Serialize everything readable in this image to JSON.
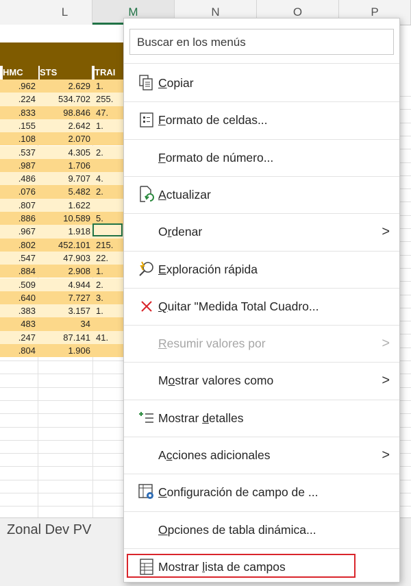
{
  "columns": [
    {
      "letter": "L",
      "selected": false
    },
    {
      "letter": "M",
      "selected": true
    },
    {
      "letter": "N",
      "selected": false
    },
    {
      "letter": "O",
      "selected": false
    },
    {
      "letter": "P",
      "selected": false
    }
  ],
  "table": {
    "headers": [
      "HMC",
      "STS",
      "TRAI"
    ],
    "rows": [
      [
        ".962",
        "2.629",
        "1."
      ],
      [
        ".224",
        "534.702",
        "255."
      ],
      [
        ".833",
        "98.846",
        "47."
      ],
      [
        ".155",
        "2.642",
        "1."
      ],
      [
        ".108",
        "2.070",
        ""
      ],
      [
        ".537",
        "4.305",
        "2."
      ],
      [
        ".987",
        "1.706",
        ""
      ],
      [
        ".486",
        "9.707",
        "4."
      ],
      [
        ".076",
        "5.482",
        "2."
      ],
      [
        ".807",
        "1.622",
        ""
      ],
      [
        ".886",
        "10.589",
        "5."
      ],
      [
        ".967",
        "1.918",
        ""
      ],
      [
        ".802",
        "452.101",
        "215."
      ],
      [
        ".547",
        "47.903",
        "22."
      ],
      [
        ".884",
        "2.908",
        "1."
      ],
      [
        ".509",
        "4.944",
        "2."
      ],
      [
        ".640",
        "7.727",
        "3."
      ],
      [
        ".383",
        "3.157",
        "1."
      ],
      [
        "483",
        "34",
        ""
      ],
      [
        ".247",
        "87.141",
        "41."
      ],
      [
        ".804",
        "1.906",
        ""
      ]
    ]
  },
  "sheet_tab": "Zonal Dev PV",
  "menu": {
    "search_placeholder": "Buscar en los menús",
    "items": [
      {
        "pre": "",
        "ul": "C",
        "post": "opiar",
        "icon": "copy-icon",
        "disabled": false,
        "submenu": false
      },
      {
        "pre": "",
        "ul": "F",
        "post": "ormato de celdas...",
        "icon": "format-cells-icon",
        "disabled": false,
        "submenu": false
      },
      {
        "pre": "",
        "ul": "F",
        "post": "ormato de número...",
        "icon": "",
        "disabled": false,
        "submenu": false
      },
      {
        "pre": "",
        "ul": "A",
        "post": "ctualizar",
        "icon": "refresh-icon",
        "disabled": false,
        "submenu": false
      },
      {
        "pre": "O",
        "ul": "r",
        "post": "denar",
        "icon": "",
        "disabled": false,
        "submenu": true
      },
      {
        "pre": "",
        "ul": "E",
        "post": "xploración rápida",
        "icon": "quick-explore-icon",
        "disabled": false,
        "submenu": false
      },
      {
        "pre": "",
        "ul": "Q",
        "post": "uitar \"Medida Total Cuadro...",
        "icon": "remove-icon",
        "disabled": false,
        "submenu": false
      },
      {
        "pre": "",
        "ul": "R",
        "post": "esumir valores por",
        "icon": "",
        "disabled": true,
        "submenu": true
      },
      {
        "pre": "M",
        "ul": "o",
        "post": "strar valores como",
        "icon": "",
        "disabled": false,
        "submenu": true
      },
      {
        "pre": "Mostrar ",
        "ul": "d",
        "post": "etalles",
        "icon": "show-details-icon",
        "disabled": false,
        "submenu": false
      },
      {
        "pre": "A",
        "ul": "c",
        "post": "ciones adicionales",
        "icon": "",
        "disabled": false,
        "submenu": true
      },
      {
        "pre": "",
        "ul": "C",
        "post": "onfiguración de campo de ...",
        "icon": "field-settings-icon",
        "disabled": false,
        "submenu": false
      },
      {
        "pre": "",
        "ul": "O",
        "post": "pciones de tabla dinámica...",
        "icon": "",
        "disabled": false,
        "submenu": false
      },
      {
        "pre": "Mostrar ",
        "ul": "l",
        "post": "ista de campos",
        "icon": "field-list-icon",
        "disabled": false,
        "submenu": false
      }
    ],
    "submenu_arrow": ">",
    "highlighted_item": "Mostrar lista de campos",
    "highlight_color": "#d9252b"
  },
  "colors": {
    "header_band": "#7f5b00",
    "row_dark": "#fcd88a",
    "row_light": "#fff1cc",
    "selection_green": "#217346"
  }
}
